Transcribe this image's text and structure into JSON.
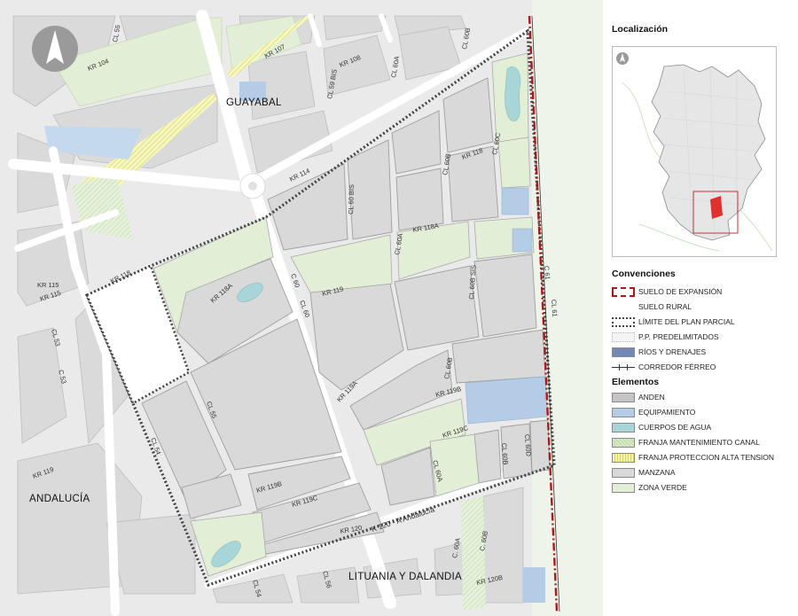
{
  "map": {
    "places": {
      "guayabal": "GUAYABAL",
      "andalucia": "ANDALUCÍA",
      "lituania": "LITUANIA Y DALANDIA"
    },
    "streets": {
      "cl55_top": "CL 55",
      "kr104": "KR 104",
      "kr107": "KR 107",
      "kr108": "KR 108",
      "cl60a_top": "CL 60A",
      "cl60b_top": "CL 60B",
      "cl59bis": "CL 59 BIS",
      "kr114": "KR 114",
      "cl60bis": "CL 60 BIS",
      "cl60b_mid": "CL 60B",
      "kr118_top": "KR 118",
      "cl60c": "CL 60C",
      "kr118a_n": "KR 118A",
      "cl60a_mid": "CL 60A",
      "cl60bsis": "CL 60B SIS",
      "kr118_left": "KR 118",
      "kr118a_w": "KR 118A",
      "kr119": "KR 119",
      "c60": "C 60",
      "cl60": "CL 60",
      "c61": "C 61",
      "cl61": "CL 61",
      "kr115a": "KR 115",
      "kr115b": "KR 115",
      "cl53": "CL 53",
      "c53": "C 53",
      "cl55_mid": "CL 55",
      "kr119a": "KR 119A",
      "cl60b_low": "CL 60B",
      "kr119b": "KR 119B",
      "cl54": "CL 54",
      "kr119c": "KR 119C",
      "cl60d": "CL 60D",
      "cl60b_2": "CL 60B",
      "cl60a_low": "CL 60A",
      "kr119b_2": "KR 119B",
      "kr119c_2": "KR 119C",
      "kr120": "K 120 - A Andalucía",
      "kr120_b": "KR 120",
      "cl54_bot": "CL 54",
      "cl56": "CL 56",
      "c60a_bot": "C. 60A",
      "c60b_bot": "C. 60B",
      "kr120b": "KR 120B"
    }
  },
  "panel": {
    "location_title": "Localización",
    "conventions_title": "Convenciones",
    "elements_title": "Elementos",
    "conventions": [
      {
        "label": "SUELO DE EXPANSIÓN",
        "icon": "expansion-boundary-icon",
        "color": "#b01818"
      },
      {
        "label": "SUELO RURAL",
        "icon": "rural-land-icon",
        "color": "#ffffff"
      },
      {
        "label": "LÍMITE DEL PLAN PARCIAL",
        "icon": "plan-limit-icon",
        "color": "#444444"
      },
      {
        "label": "P.P. PREDELIMITADOS",
        "icon": "predelimited-plan-icon",
        "color": "#f4f4f4"
      },
      {
        "label": "RÍOS Y DRENAJES",
        "icon": "rivers-icon",
        "color": "#7488b8"
      },
      {
        "label": "CORREDOR FÉRREO",
        "icon": "railway-icon",
        "color": "#333333"
      }
    ],
    "elements": [
      {
        "label": "ANDEN",
        "icon": "sidewalk-icon",
        "color": "#c4c4c4"
      },
      {
        "label": "EQUIPAMIENTO",
        "icon": "equipment-icon",
        "color": "#b4cce6"
      },
      {
        "label": "CUERPOS DE AGUA",
        "icon": "water-body-icon",
        "color": "#a8d6d8"
      },
      {
        "label": "FRANJA MANTENIMIENTO CANAL",
        "icon": "canal-strip-icon",
        "color": "#d8ebc8"
      },
      {
        "label": "FRANJA PROTECCION ALTA TENSION",
        "icon": "high-voltage-strip-icon",
        "color": "#f2f2a8"
      },
      {
        "label": "MANZANA",
        "icon": "block-icon",
        "color": "#d9d9d9"
      },
      {
        "label": "ZONA VERDE",
        "icon": "green-zone-icon",
        "color": "#e2efd6"
      }
    ]
  }
}
